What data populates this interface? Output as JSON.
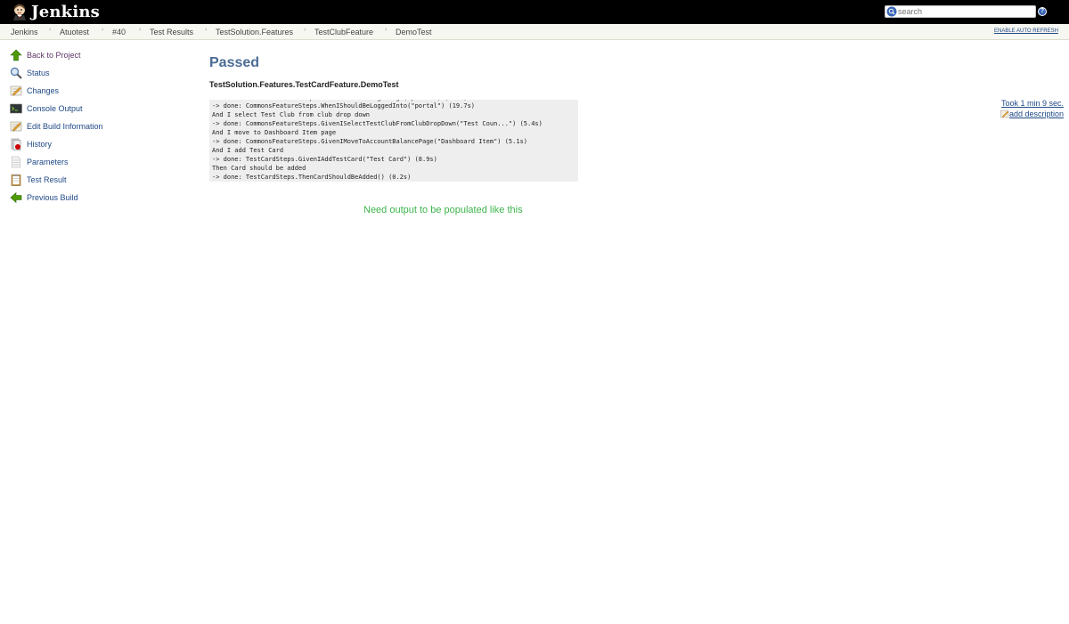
{
  "header": {
    "logo_text": "Jenkins",
    "search_placeholder": "search",
    "help_label": "?"
  },
  "breadcrumb": {
    "items": [
      "Jenkins",
      "Atuotest",
      "#40",
      "Test Results",
      "TestSolution.Features",
      "TestClubFeature",
      "DemoTest"
    ],
    "auto_refresh": "ENABLE AUTO REFRESH"
  },
  "sidebar": {
    "items": [
      {
        "label": "Back to Project",
        "icon": "up-arrow-icon"
      },
      {
        "label": "Status",
        "icon": "magnifier-icon"
      },
      {
        "label": "Changes",
        "icon": "notepad-icon"
      },
      {
        "label": "Console Output",
        "icon": "terminal-icon"
      },
      {
        "label": "Edit Build Information",
        "icon": "notepad-icon"
      },
      {
        "label": "History",
        "icon": "history-icon"
      },
      {
        "label": "Parameters",
        "icon": "document-icon"
      },
      {
        "label": "Test Result",
        "icon": "clipboard-icon"
      },
      {
        "label": "Previous Build",
        "icon": "left-arrow-icon"
      }
    ]
  },
  "main": {
    "status": "Passed",
    "test_name": "TestSolution.Features.TestCardFeature.DemoTest",
    "console_lines": [
      "-> done: CommonsFeatureSteps.WhenIShouldBeLoggedInto(\"portal\") (19.7s)",
      "And I select Test Club from club drop down",
      "-> done: CommonsFeatureSteps.GivenISelectTestClubFromClubDropDown(\"Test Coun...\") (5.4s)",
      "And I move to Dashboard Item page",
      "-> done: CommonsFeatureSteps.GivenIMoveToAccountBalancePage(\"Dashboard Item\") (5.1s)",
      "And I add Test Card",
      "-> done: TestCardSteps.GivenIAddTestCard(\"Test Card\") (8.9s)",
      "Then Card should be added",
      "-> done: TestCardSteps.ThenCardShouldBeAdded() (0.2s)"
    ],
    "note": "Need output to be populated like this",
    "took": "Took 1 min 9 sec.",
    "add_description": "add description"
  },
  "colors": {
    "accent": "#4a6b94",
    "link": "#204a87",
    "note": "#3cb44b"
  }
}
